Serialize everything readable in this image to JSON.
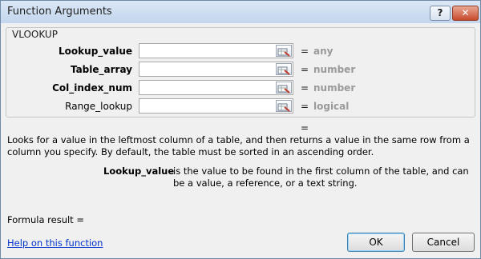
{
  "window": {
    "title": "Function Arguments"
  },
  "titlebar": {
    "help_label": "?",
    "close_label": "✕"
  },
  "function": {
    "name": "VLOOKUP"
  },
  "arguments": [
    {
      "label": "Lookup_value",
      "value": "",
      "equals": "=",
      "hint": "any",
      "bold": true
    },
    {
      "label": "Table_array",
      "value": "",
      "equals": "=",
      "hint": "number",
      "bold": true
    },
    {
      "label": "Col_index_num",
      "value": "",
      "equals": "=",
      "hint": "number",
      "bold": true
    },
    {
      "label": "Range_lookup",
      "value": "",
      "equals": "=",
      "hint": "logical",
      "bold": false
    }
  ],
  "result": {
    "equals": "="
  },
  "description": "Looks for a value in the leftmost column of a table, and then returns a value in the same row from a column you specify. By default, the table must be sorted in an ascending order.",
  "current_argument": {
    "name": "Lookup_value",
    "text": "is the value to be found in the first column of the table, and can be a value, a reference, or a text string."
  },
  "formula_result": "Formula result =",
  "help_link": "Help on this function",
  "buttons": {
    "ok": "OK",
    "cancel": "Cancel"
  }
}
